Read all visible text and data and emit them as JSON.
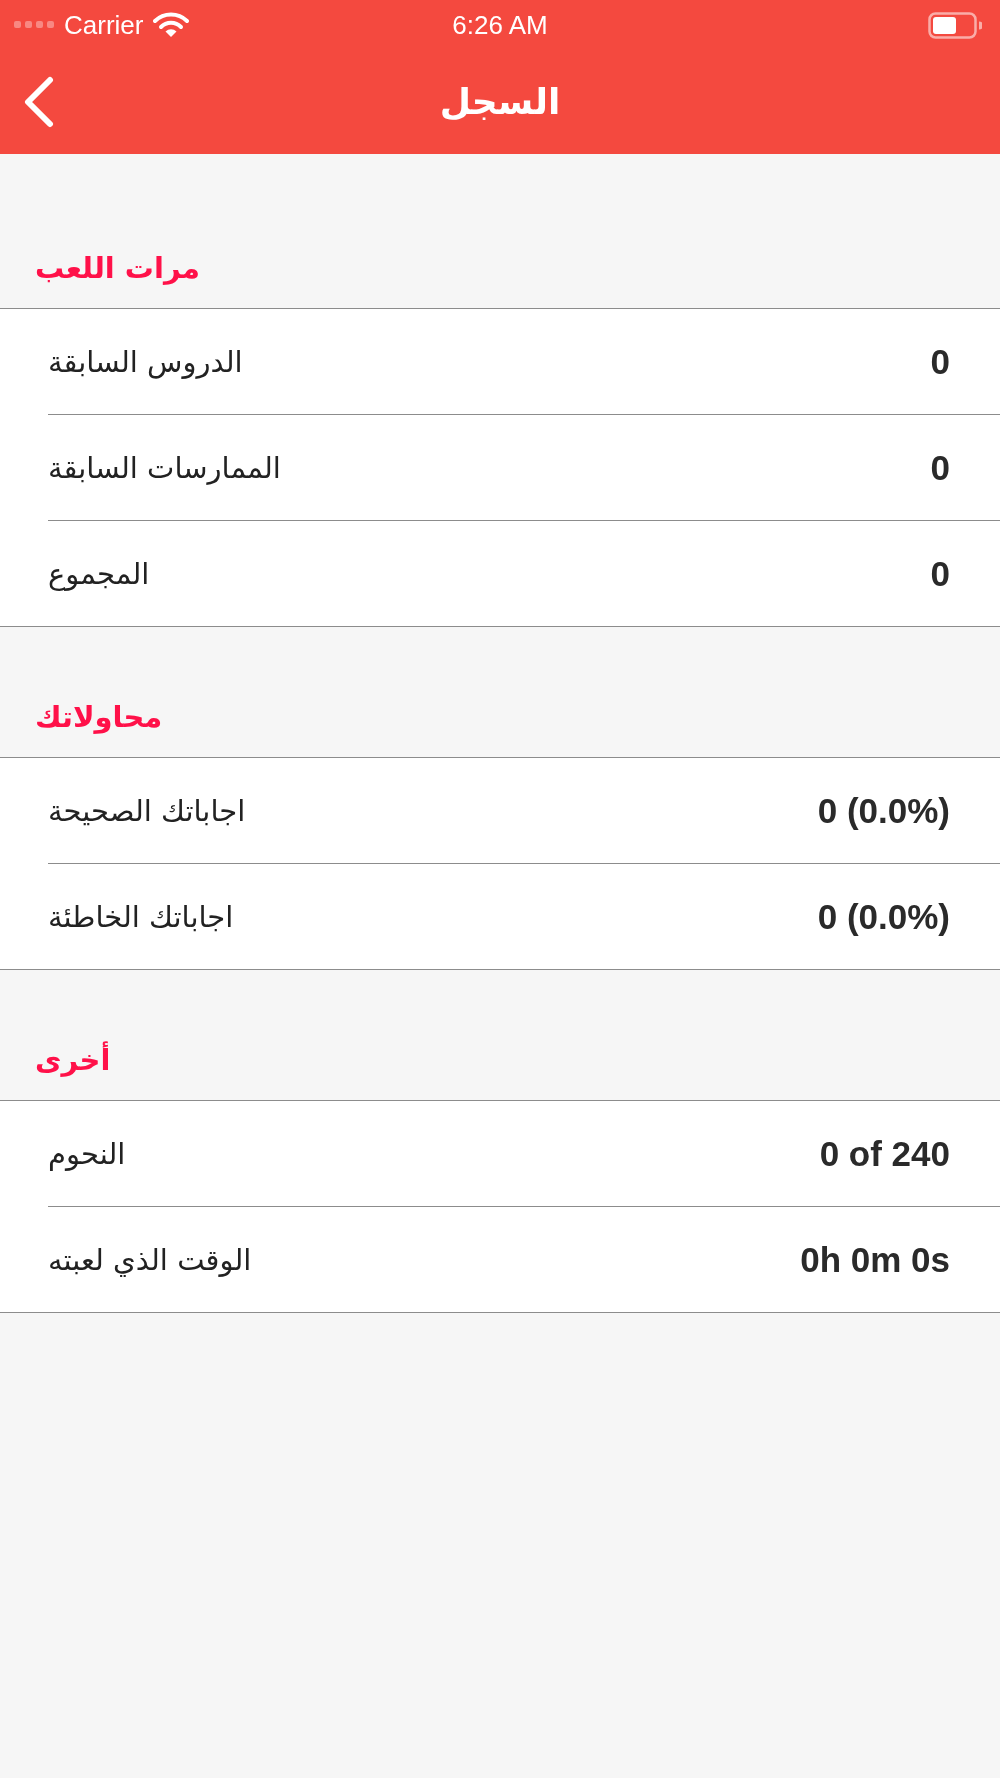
{
  "status_bar": {
    "carrier": "Carrier",
    "time": "6:26 AM"
  },
  "nav_bar": {
    "title": "السجل"
  },
  "sections": [
    {
      "title": "مرات اللعب",
      "rows": [
        {
          "label": "الدروس السابقة",
          "value": "0"
        },
        {
          "label": "الممارسات السابقة",
          "value": "0"
        },
        {
          "label": "المجموع",
          "value": "0"
        }
      ]
    },
    {
      "title": "محاولاتك",
      "rows": [
        {
          "label": "اجاباتك الصحيحة",
          "value": "0 (0.0%)"
        },
        {
          "label": "اجاباتك الخاطئة",
          "value": "0 (0.0%)"
        }
      ]
    },
    {
      "title": "أخرى",
      "rows": [
        {
          "label": "النحوم",
          "value": "0 of 240"
        },
        {
          "label": "الوقت الذي لعبته",
          "value": "0h 0m 0s"
        }
      ]
    }
  ]
}
